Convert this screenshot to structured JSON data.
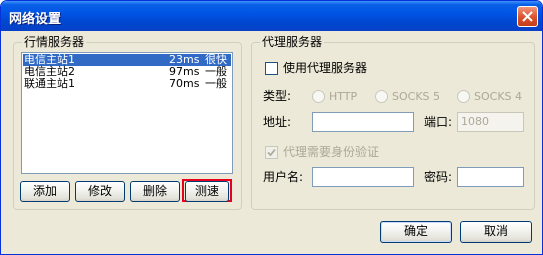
{
  "window": {
    "title": "网络设置"
  },
  "quote_servers": {
    "legend": "行情服务器",
    "rows": [
      {
        "name": "电信主站1",
        "latency": "23ms",
        "quality": "很快"
      },
      {
        "name": "电信主站2",
        "latency": "97ms",
        "quality": "一般"
      },
      {
        "name": "联通主站1",
        "latency": "70ms",
        "quality": "一般"
      }
    ],
    "buttons": {
      "add": "添加",
      "edit": "修改",
      "delete": "删除",
      "test": "测速"
    }
  },
  "proxy": {
    "legend": "代理服务器",
    "use_proxy_label": "使用代理服务器",
    "type_label": "类型:",
    "type_options": [
      "HTTP",
      "SOCKS 5",
      "SOCKS 4"
    ],
    "address_label": "地址:",
    "address_value": "",
    "port_label": "端口:",
    "port_placeholder": "1080",
    "auth_label": "代理需要身份验证",
    "username_label": "用户名:",
    "username_value": "",
    "password_label": "密码:",
    "password_value": ""
  },
  "footer": {
    "ok": "确定",
    "cancel": "取消"
  },
  "colors": {
    "title_bar": "#0055e5",
    "selection": "#316ac5",
    "highlight_border": "#e8001c",
    "dialog_bg": "#ece9d8"
  }
}
